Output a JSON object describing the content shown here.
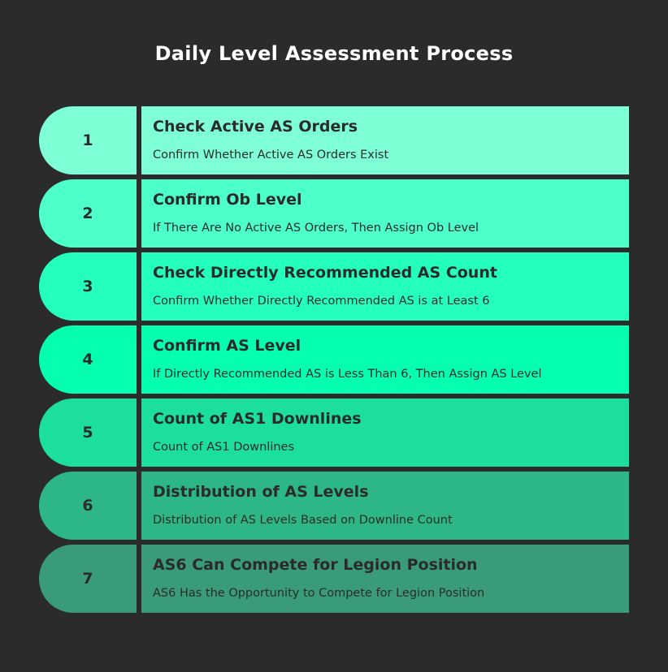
{
  "title": "Daily Level Assessment Process",
  "colors": {
    "background": "#2b2b2b",
    "text_dark": "#2b2b2b",
    "title_text": "#ffffff"
  },
  "steps": [
    {
      "number": "1",
      "title": "Check Active AS Orders",
      "description": "Confirm Whether Active AS Orders Exist",
      "color": "#7effd6"
    },
    {
      "number": "2",
      "title": "Confirm Ob Level",
      "description": "If There Are No Active AS Orders, Then Assign Ob Level",
      "color": "#4dffc9"
    },
    {
      "number": "3",
      "title": "Check Directly Recommended AS Count",
      "description": "Confirm Whether Directly Recommended AS is at Least 6",
      "color": "#24ffbd"
    },
    {
      "number": "4",
      "title": "Confirm AS Level",
      "description": "If Directly Recommended AS is Less Than 6, Then Assign AS Level",
      "color": "#05feb0"
    },
    {
      "number": "5",
      "title": "Count of AS1 Downlines",
      "description": "Count of AS1 Downlines",
      "color": "#1cdf9f"
    },
    {
      "number": "6",
      "title": "Distribution of AS Levels",
      "description": "Distribution of AS Levels Based on Downline Count",
      "color": "#2eb786"
    },
    {
      "number": "7",
      "title": "AS6 Can Compete for Legion Position",
      "description": "AS6 Has the Opportunity to Compete for Legion Position",
      "color": "#3a9b79"
    }
  ]
}
